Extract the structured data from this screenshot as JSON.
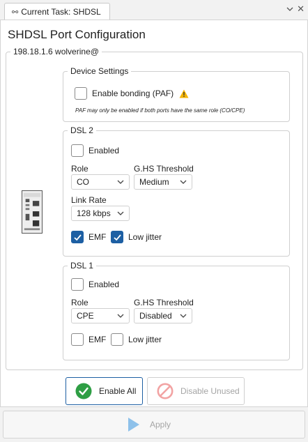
{
  "tab": {
    "title": "Current Task: SHDSL"
  },
  "page": {
    "title": "SHDSL Port Configuration"
  },
  "device": {
    "label": "198.18.1.6 wolverine@"
  },
  "device_settings": {
    "legend": "Device Settings",
    "bonding_label": "Enable bonding (PAF)",
    "bonding_checked": false,
    "note": "PAF may only be enabled if both ports have the same role (CO/CPE)"
  },
  "dsl2": {
    "legend": "DSL 2",
    "enabled_label": "Enabled",
    "enabled_checked": false,
    "role_label": "Role",
    "role_value": "CO",
    "ghs_label": "G.HS Threshold",
    "ghs_value": "Medium",
    "link_rate_label": "Link Rate",
    "link_rate_value": "128 kbps",
    "emf_label": "EMF",
    "emf_checked": true,
    "low_jitter_label": "Low jitter",
    "low_jitter_checked": true
  },
  "dsl1": {
    "legend": "DSL 1",
    "enabled_label": "Enabled",
    "enabled_checked": false,
    "role_label": "Role",
    "role_value": "CPE",
    "ghs_label": "G.HS Threshold",
    "ghs_value": "Disabled",
    "emf_label": "EMF",
    "emf_checked": false,
    "low_jitter_label": "Low jitter",
    "low_jitter_checked": false
  },
  "actions": {
    "enable_all": "Enable All",
    "disable_unused": "Disable Unused",
    "apply": "Apply"
  },
  "colors": {
    "accent": "#1d5fa3",
    "success": "#2e9e44",
    "disabled_red": "#f2a3a3",
    "warning": "#f4b400",
    "apply_disabled": "#8ec1ea"
  },
  "icons": {
    "tab": "link-icon",
    "warning": "warning-icon",
    "enable_all": "check-circle-icon",
    "disable_unused": "block-icon",
    "apply": "play-icon",
    "dropdown": "chevron-down-icon",
    "close": "close-icon"
  }
}
